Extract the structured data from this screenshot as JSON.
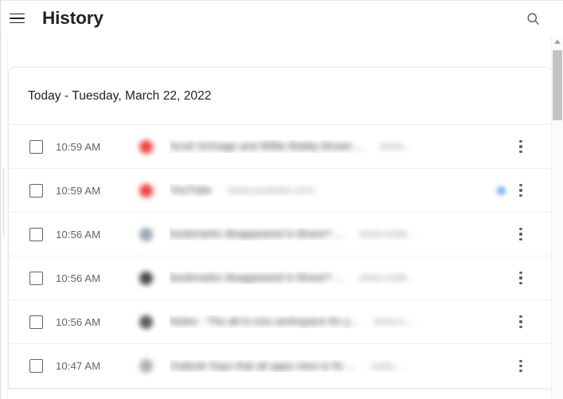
{
  "window": {
    "background_color": "#ffffff"
  },
  "toolbar": {
    "menu_icon": "hamburger-menu-icon",
    "title": "History",
    "search_icon": "search-icon"
  },
  "history": {
    "date_header": "Today - Tuesday, March 22, 2022",
    "columns": [
      "select",
      "time",
      "favicon",
      "title",
      "url",
      "actions"
    ],
    "rows": [
      {
        "time": "10:59 AM",
        "favicon_color": "#f2423f",
        "title": "Scott Schrage and Willie Bobby Brown ...",
        "url": "www...",
        "trailing_dot_color": "",
        "menu_icon": "more-vertical-icon",
        "checked": false
      },
      {
        "time": "10:59 AM",
        "favicon_color": "#f2423f",
        "title": "YouTube",
        "url": "www.youtube.com",
        "trailing_dot_color": "#7cb0f0",
        "menu_icon": "more-vertical-icon",
        "checked": false
      },
      {
        "time": "10:56 AM",
        "favicon_color": "#9aa6b2",
        "title": "bookmarks disappeared in Brave? ...",
        "url": "www.redd...",
        "trailing_dot_color": "",
        "menu_icon": "more-vertical-icon",
        "checked": false
      },
      {
        "time": "10:56 AM",
        "favicon_color": "#4a4a4a",
        "title": "bookmarks disappeared in Brave? ...",
        "url": "www.redd...",
        "trailing_dot_color": "",
        "menu_icon": "more-vertical-icon",
        "checked": false
      },
      {
        "time": "10:56 AM",
        "favicon_color": "#5a5a5a",
        "title": "Notes - The all-in-one workspace for y...",
        "url": "www.n...",
        "trailing_dot_color": "",
        "menu_icon": "more-vertical-icon",
        "checked": false
      },
      {
        "time": "10:47 AM",
        "favicon_color": "#b0b0b0",
        "title": "Outlook Says that all apps view to fix ...",
        "url": "outlo...",
        "trailing_dot_color": "",
        "menu_icon": "more-vertical-icon",
        "checked": false
      }
    ]
  },
  "scrollbar": {
    "up_arrow_icon": "chevron-up-icon",
    "thumb_position_percent": 4
  }
}
